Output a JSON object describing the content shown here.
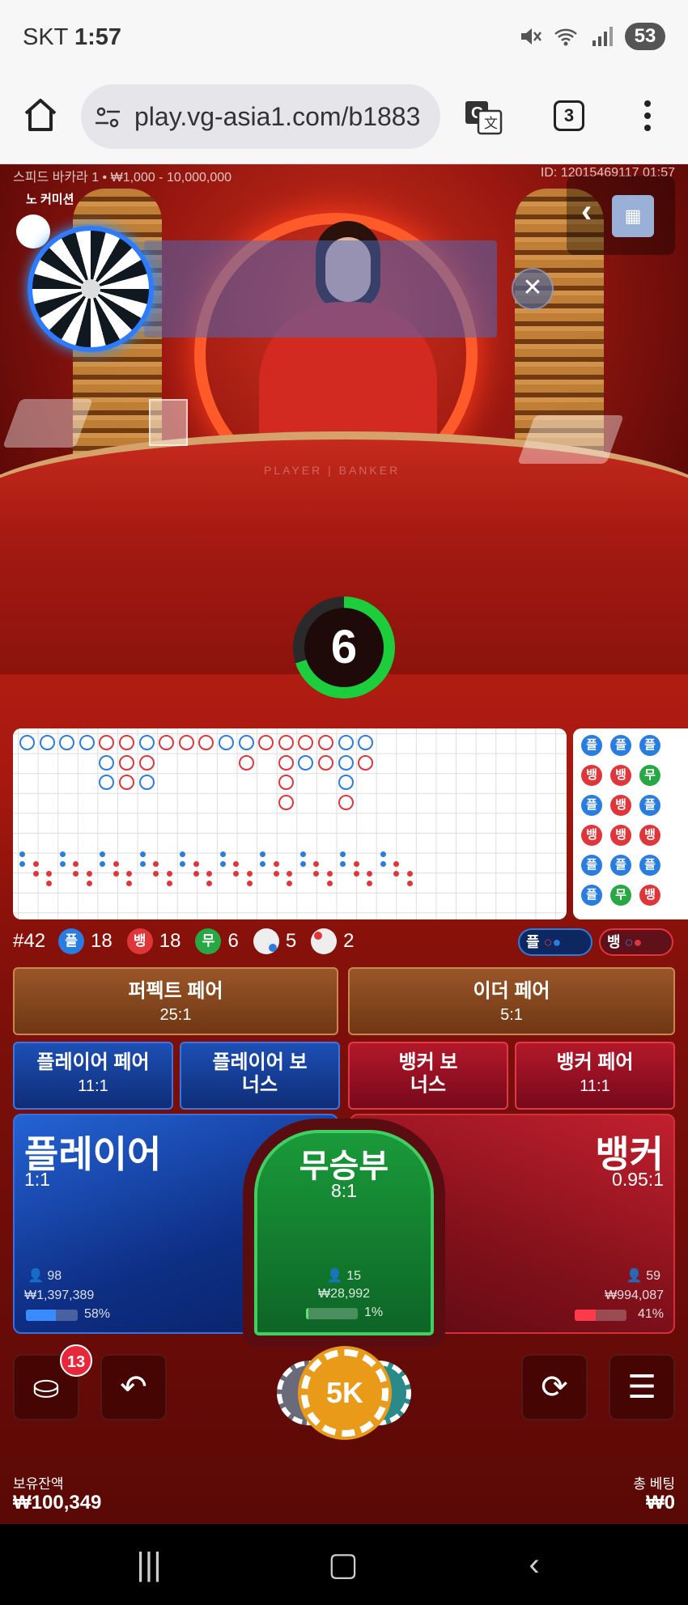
{
  "status": {
    "carrier": "SKT",
    "time": "1:57",
    "battery": "53"
  },
  "browser": {
    "url": "play.vg-asia1.com/b1883",
    "tab_count": "3"
  },
  "game": {
    "table_info": "스피드 바카라 1 • ₩1,000 - 10,000,000",
    "round_id": "ID: 12015469117 01:57",
    "no_commission": "노 커미션",
    "table_print": "PLAYER | BANKER",
    "countdown": "6",
    "countdown_fraction": 0.7
  },
  "stats": {
    "shoe": "#42",
    "player_chip": "플",
    "player_count": "18",
    "banker_chip": "뱅",
    "banker_count": "18",
    "tie_chip": "무",
    "tie_count": "6",
    "player_pair_count": "5",
    "banker_pair_count": "2",
    "pred_player": "플",
    "pred_banker": "뱅"
  },
  "side_bets": {
    "perfect_pair": {
      "label": "퍼펙트 페어",
      "odds": "25:1"
    },
    "either_pair": {
      "label": "이더 페어",
      "odds": "5:1"
    },
    "player_pair": {
      "label": "플레이어 페어",
      "odds": "11:1"
    },
    "player_bonus": {
      "label": "플레이어 보너스"
    },
    "banker_bonus": {
      "label": "뱅커 보너스"
    },
    "banker_pair": {
      "label": "뱅커 페어",
      "odds": "11:1"
    }
  },
  "main_bets": {
    "player": {
      "label": "플레이어",
      "odds": "1:1",
      "bettors": "98",
      "amount": "₩1,397,389",
      "percent": "58%",
      "share": 0.58
    },
    "tie": {
      "label": "무승부",
      "odds": "8:1",
      "bettors": "15",
      "amount": "₩28,992",
      "percent": "1%",
      "share": 0.01
    },
    "banker": {
      "label": "뱅커",
      "odds": "0.95:1",
      "bettors": "59",
      "amount": "₩994,087",
      "percent": "41%",
      "share": 0.41
    }
  },
  "controls": {
    "chip_badge": "13",
    "selected_chip": "5K"
  },
  "footer": {
    "balance_label": "보유잔액",
    "balance": "₩100,349",
    "total_bet_label": "총 베팅",
    "total_bet": "₩0"
  },
  "bead_road": [
    [
      "플",
      "플",
      "플"
    ],
    [
      "뱅",
      "뱅",
      "무"
    ],
    [
      "플",
      "뱅",
      "플"
    ],
    [
      "뱅",
      "뱅",
      "뱅"
    ],
    [
      "플",
      "플",
      "플"
    ],
    [
      "플",
      "무",
      "뱅"
    ]
  ],
  "colors": {
    "player": "#2a7de0",
    "banker": "#e0363a",
    "tie": "#27a844",
    "accent_gold": "#e89a18"
  }
}
